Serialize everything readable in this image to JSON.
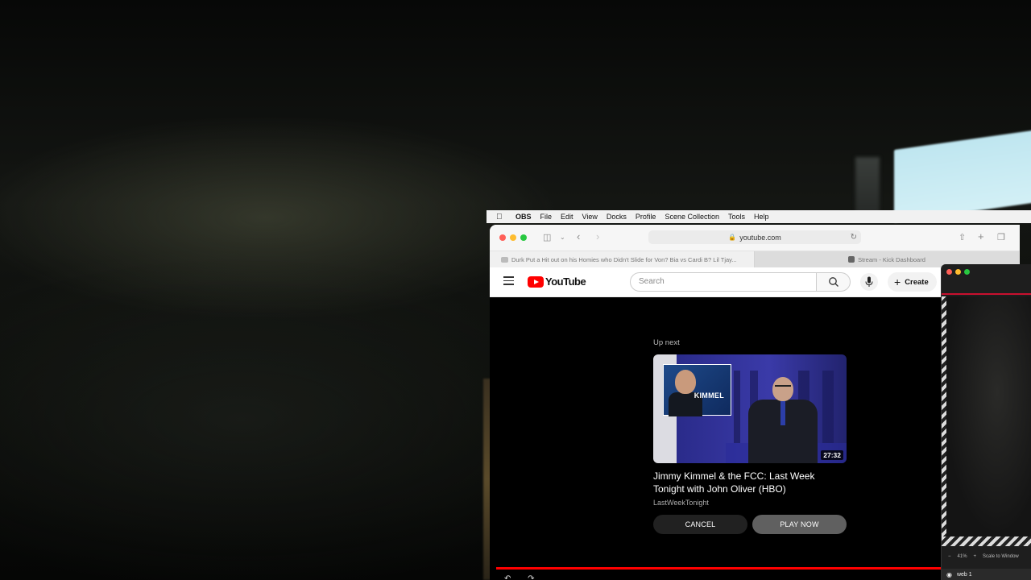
{
  "menubar": {
    "app": "OBS",
    "items": [
      "File",
      "Edit",
      "View",
      "Docks",
      "Profile",
      "Scene Collection",
      "Tools",
      "Help"
    ]
  },
  "safari": {
    "url": "youtube.com",
    "tabs": [
      {
        "title": "Durk Put a Hit out on his Homies who Didn't Slide for Von? Bia vs Cardi B? Lil Tjay..."
      },
      {
        "title": "Stream - Kick Dashboard"
      }
    ]
  },
  "youtube": {
    "logo_text": "YouTube",
    "search_placeholder": "Search",
    "create_label": "Create",
    "up_next_label": "Up next",
    "video": {
      "thumbnail_text": "KIMMEL",
      "duration": "27:32",
      "title": "Jimmy Kimmel & the FCC: Last Week Tonight with John Oliver (HBO)",
      "channel": "LastWeekTonight"
    },
    "cancel_label": "CANCEL",
    "play_now_label": "PLAY NOW"
  },
  "obs": {
    "zoom": "41%",
    "scale_label": "Scale to Window",
    "source": "web 1"
  },
  "colors": {
    "youtube_red": "#ff0000",
    "close": "#ff5f57",
    "minimize": "#febc2e",
    "zoom": "#28c840"
  }
}
